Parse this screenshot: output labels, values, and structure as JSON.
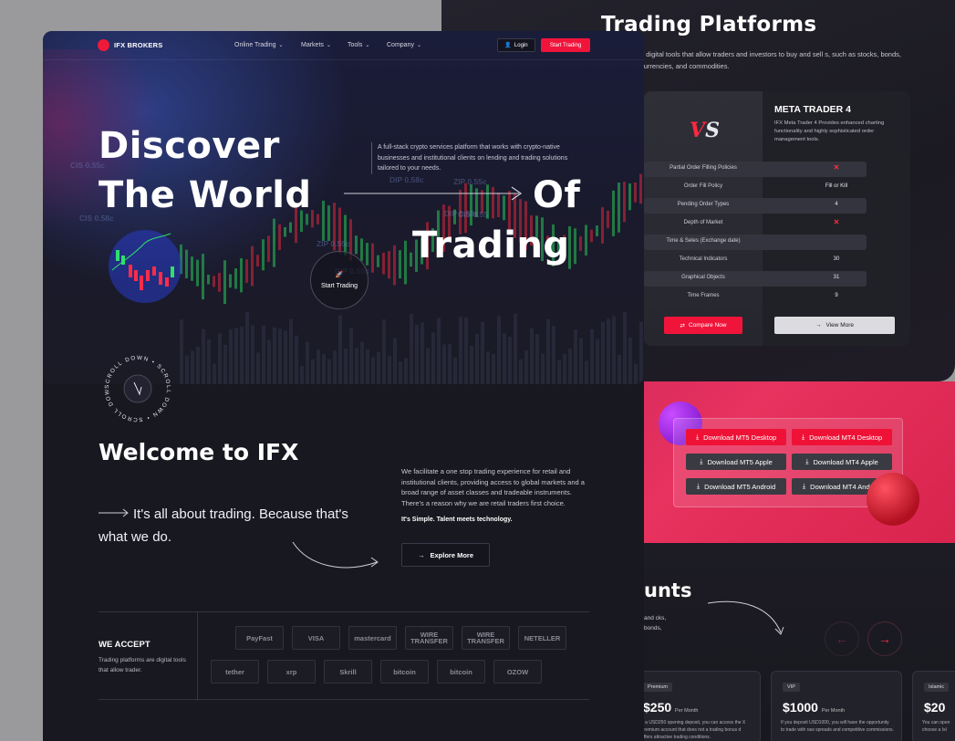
{
  "platforms": {
    "title": "Trading Platforms",
    "subtitle": "e digital tools that allow traders and investors to buy and sell s, such as stocks, bonds, currencies, and commodities.",
    "logo_text": "VS",
    "name": "META TRADER 4",
    "description": "IFX Meta Trader 4 Provides enhanced charting functionality and highly sophisticated order management tools.",
    "rows": [
      {
        "label": "Partial Order Filling Policies",
        "value": "✕",
        "type": "x"
      },
      {
        "label": "Order Fill Policy",
        "value": "Fill or Kill",
        "type": "text"
      },
      {
        "label": "Pending Order Types",
        "value": "4",
        "type": "text"
      },
      {
        "label": "Depth of Market",
        "value": "✕",
        "type": "x"
      },
      {
        "label": "Time & Seles (Exchange date)",
        "value": "",
        "type": "text"
      },
      {
        "label": "Technical Indicators",
        "value": "30",
        "type": "text"
      },
      {
        "label": "Graphical Objects",
        "value": "31",
        "type": "text"
      },
      {
        "label": "Time Frames",
        "value": "9",
        "type": "text"
      }
    ],
    "compare_label": "Compare Now",
    "view_more_label": "View More"
  },
  "downloads": [
    {
      "label": "Download MT5 Desktop",
      "style": "red"
    },
    {
      "label": "Download MT4 Desktop",
      "style": "red"
    },
    {
      "label": "Download MT5 Apple",
      "style": "dark"
    },
    {
      "label": "Download MT4 Apple",
      "style": "dark"
    },
    {
      "label": "Download MT5 Android",
      "style": "dark"
    },
    {
      "label": "Download MT4 Android",
      "style": "dark"
    }
  ],
  "accounts": {
    "title": "unts",
    "text": "and cks, bonds,",
    "prev_icon": "←",
    "next_icon": "→",
    "cards": [
      {
        "badge": "Premium",
        "price": "$250",
        "per": "Per Month",
        "desc": "h a USD250 opening deposit, you can access the X Premium account that does not a trading bonus d offers attractive trading conditions."
      },
      {
        "badge": "VIP",
        "price": "$1000",
        "per": "Per Month",
        "desc": "If you deposit USD1000, you will have the opportunity to trade with raw spreads and competitive commissions."
      },
      {
        "badge": "Islamic",
        "price": "$20",
        "per": "",
        "desc": "You can open choose a Isl"
      }
    ]
  },
  "nav": {
    "brand": "IFX BROKERS",
    "items": [
      "Online Trading",
      "Markets",
      "Tools",
      "Company"
    ],
    "login_label": "Login",
    "start_label": "Start Trading"
  },
  "hero": {
    "line1": "Discover",
    "line2": "The World",
    "line3": "Of",
    "line4": "Trading",
    "description": "A full-stack crypto services platform that works with crypto-native businesses and institutional clients on lending and trading solutions tailored to your needs.",
    "cta_label": "Start Trading",
    "scroll_text": "SCROLL DOWN • SCROLL DOWN • SCROLL DOWN •",
    "tickers": [
      "CIS 0.55c",
      "DIP 0.58c",
      "CIS 0.58c",
      "ZIP 0.55c",
      "ZIP 0.55c",
      "DIP 0.55c",
      "DIP 0.58c",
      "CIS 0.55"
    ]
  },
  "welcome": {
    "title": "Welcome to IFX",
    "tagline": "It's all about trading. Because that's what we do.",
    "text": "We facilitate a one stop trading experience for retail and institutional clients, providing access to global markets and a broad range of asset classes and tradeable instruments. There's a reason why we are retail traders first choice.",
    "strong": "It's Simple. Talent meets technology.",
    "explore_label": "Explore More"
  },
  "accept": {
    "title": "WE ACCEPT",
    "desc": "Trading platforms are digital tools that allow trader.",
    "methods_row1": [
      "PayFast",
      "VISA",
      "mastercard",
      "WIRE TRANSFER",
      "WIRE TRANSFER",
      "NETELLER"
    ],
    "methods_row2": [
      "tether",
      "xrp",
      "Skrill",
      "bitcoin",
      "bitcoin",
      "OZOW"
    ]
  }
}
